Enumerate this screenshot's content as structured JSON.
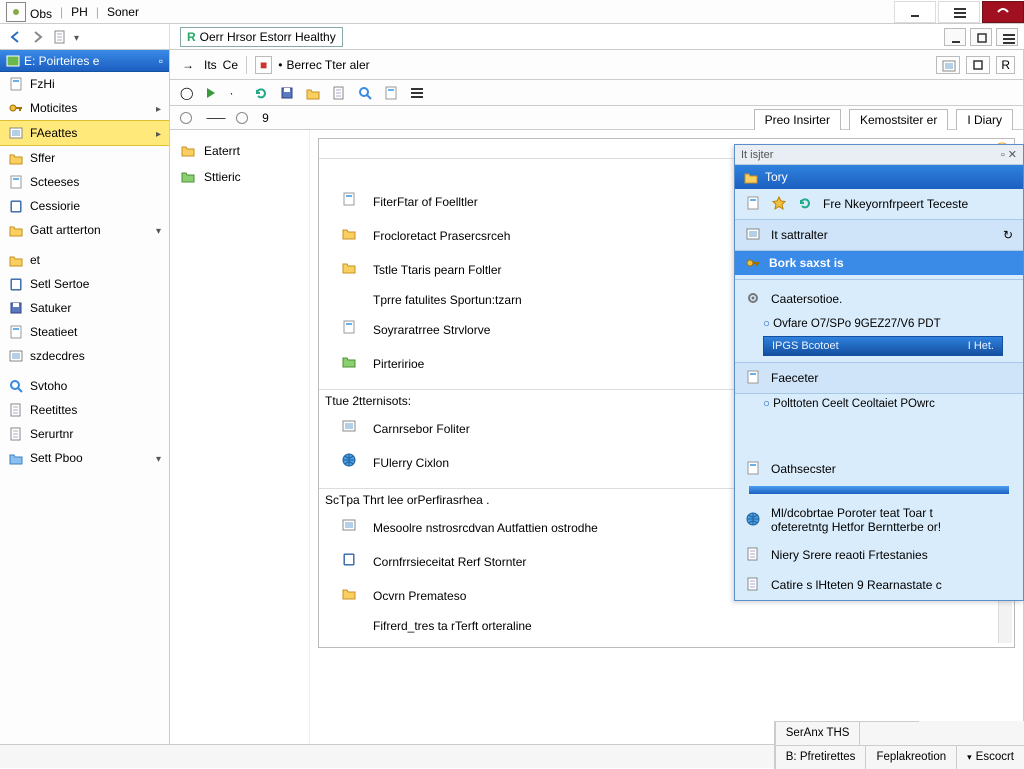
{
  "titlebar": {
    "left_items": [
      "Obs",
      "PH",
      "Soner"
    ],
    "window_buttons": [
      "minimize",
      "maximize",
      "close"
    ]
  },
  "win2": {
    "title_prefix": "R",
    "title": "Oerr Hrsor Estorr Healthy"
  },
  "toolbar1": {
    "btn1": "Its",
    "btn2": "Ce",
    "boxed_icon": "●",
    "boxed_label": "Berrec Tter aler"
  },
  "tabs": {
    "left_num": "9",
    "tab1": "Preo Insirter",
    "tab2": "Kemostsiter er",
    "tab3": "I Diary"
  },
  "left": {
    "header": "E: Poirteires e",
    "items": [
      {
        "label": "FzHi"
      },
      {
        "label": "Moticites",
        "caret": true
      },
      {
        "label": "FAeattes",
        "caret": true,
        "selected": true
      },
      {
        "label": "Sffer"
      },
      {
        "label": "Scteeses"
      },
      {
        "label": "Cessiorie"
      },
      {
        "label": "Gatt artterton",
        "caret": true
      }
    ],
    "items2": [
      {
        "label": "et"
      },
      {
        "label": "Setl Sertoe"
      },
      {
        "label": "Satuker"
      },
      {
        "label": "Steatieet"
      },
      {
        "label": "szdecdres"
      }
    ],
    "items3": [
      {
        "label": "Svtoho"
      },
      {
        "label": "Reetittes"
      },
      {
        "label": "Serurtnr"
      },
      {
        "label": "Sett Pboo",
        "caret": true
      }
    ]
  },
  "folders": {
    "item1": "Eaterrt",
    "item2": "Sttieric"
  },
  "taskpanel": {
    "group1_title": " ",
    "items1": [
      "FiterFtar of Foelltler",
      "Frocloretact Prasercsrceh",
      "Tstle Ttaris pearn Foltler",
      "Tprre fatulites Sportun:tzarn",
      "Soyraratrree Strvlorve",
      "Pirteririoe"
    ],
    "group2_title": "Ttue 2tternisots:",
    "items2": [
      "Carnrsebor Foliter",
      "FUlerry Cixlon"
    ],
    "group3_title": "ScTpa Thrt lee orPerfirasrhea .",
    "items3": [
      "Mesoolre nstrosrcdvan Autfattien ostrodhe",
      "Cornfrrsieceitat Rerf Stornter",
      "Ocvrn Premateso",
      "Fifrerd_tres ta rTerft orteraline"
    ]
  },
  "rightpanel": {
    "small_tab": "It isjter",
    "header_label": "Tory",
    "row1": "Fre Nkeyornfrpeert Teceste",
    "row2": "It sattralter",
    "section_head": "Bork saxst is",
    "row3": "Caatersotioe.",
    "sub1": "Ovfare O7/SPo 9GEZ27/V6 PDT",
    "code_left": "IPGS Bcotoet",
    "code_right": "I Het.",
    "row4": "Faeceter",
    "sub2": "Polttoten Ceelt Ceoltaiet POwrc",
    "row5": "Oathsecster",
    "body1": "Ml/dcobrtae Poroter teat Toar t",
    "body2": "ofeteretntg Hetfor Berntterbe or!",
    "link1": "Niery Srere reaoti Frtestanies",
    "link2": "Catire s lHteten 9 Rearnastate c"
  },
  "statusbar": {
    "top_cells": [
      "SerAnx THS",
      ""
    ],
    "bottom_cells": [
      "B: Pfretirettes",
      "Feplakreotion",
      "Escocrt"
    ]
  }
}
